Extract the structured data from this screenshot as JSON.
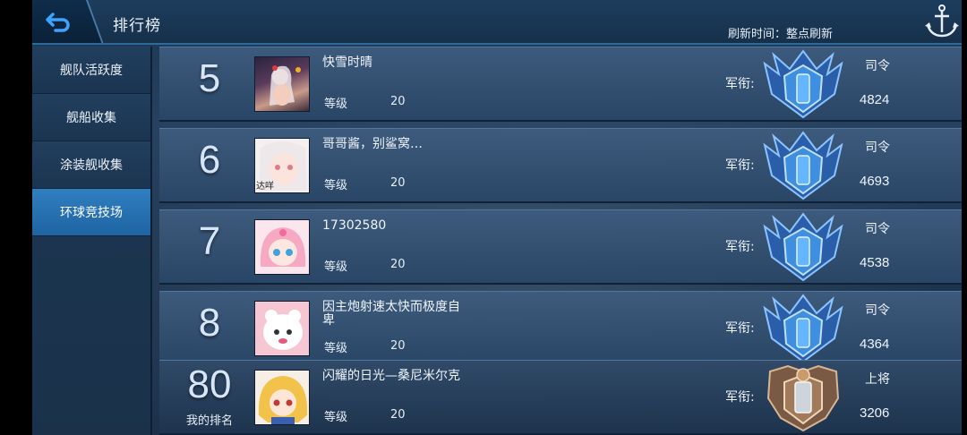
{
  "header": {
    "title": "排行榜",
    "refresh_text": "刷新时间：整点刷新"
  },
  "sidebar": {
    "items": [
      {
        "label": "舰队活跃度",
        "active": false
      },
      {
        "label": "舰船收集",
        "active": false
      },
      {
        "label": "涂装舰收集",
        "active": false
      },
      {
        "label": "环球竞技场",
        "active": true
      }
    ]
  },
  "rows": [
    {
      "rank": "5",
      "name": "快雪时晴",
      "level_label": "等级",
      "level": "20",
      "rank_label": "军衔:",
      "title": "司令",
      "points": "4824"
    },
    {
      "rank": "6",
      "name": "哥哥酱，别鲨窝…",
      "level_label": "等级",
      "level": "20",
      "rank_label": "军衔:",
      "title": "司令",
      "points": "4693",
      "avatar_text": "达咩"
    },
    {
      "rank": "7",
      "name": "17302580",
      "level_label": "等级",
      "level": "20",
      "rank_label": "军衔:",
      "title": "司令",
      "points": "4538"
    },
    {
      "rank": "8",
      "name": "因主炮射速太快而极度自卑",
      "level_label": "等级",
      "level": "20",
      "rank_label": "军衔:",
      "title": "司令",
      "points": "4364"
    }
  ],
  "my_row": {
    "rank": "80",
    "my_rank_label": "我的排名",
    "name": "闪耀的日光—桑尼米尔克",
    "level_label": "等级",
    "level": "20",
    "rank_label": "军衔:",
    "title": "上将",
    "points": "3206"
  },
  "colors": {
    "accent": "#2f7fc0",
    "emblem_blue": "#3f8fe0",
    "emblem_bronze": "#a07a5a"
  },
  "icons": [
    "back-arrow-icon",
    "anchor-icon",
    "commander-emblem-icon",
    "admiral-emblem-icon"
  ]
}
